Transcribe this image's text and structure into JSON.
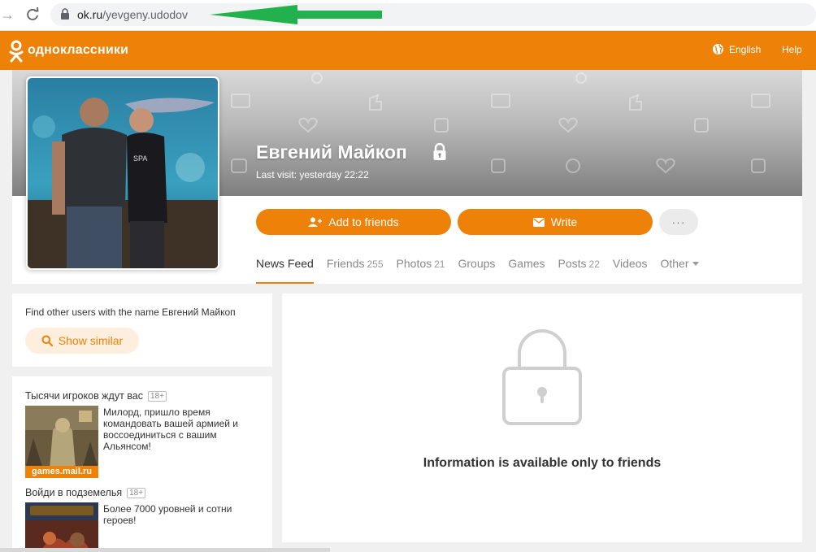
{
  "browser": {
    "url_domain": "ok.ru",
    "url_path": "/yevgeny.udodov"
  },
  "header": {
    "brand": "одноклассники",
    "language": "English",
    "help": "Help",
    "accent_color": "#ee8208"
  },
  "profile": {
    "name": "Евгений Майкоп",
    "last_visit": "Last visit: yesterday 22:22",
    "add_friend_label": "Add to friends",
    "write_label": "Write",
    "more_label": "···"
  },
  "tabs": [
    {
      "label": "News Feed",
      "count": ""
    },
    {
      "label": "Friends",
      "count": "255"
    },
    {
      "label": "Photos",
      "count": "21"
    },
    {
      "label": "Groups",
      "count": ""
    },
    {
      "label": "Games",
      "count": ""
    },
    {
      "label": "Posts",
      "count": "22"
    },
    {
      "label": "Videos",
      "count": ""
    },
    {
      "label": "Other",
      "count": ""
    }
  ],
  "sidebar": {
    "similar_text": "Find other users with the name Евгений Майкоп",
    "show_similar_label": "Show similar",
    "ads": [
      {
        "title": "Тысячи игроков ждут вас",
        "age": "18+",
        "desc": "Милорд, пришло время командовать вашей армией и воссоединиться с вашим Альянсом!",
        "source": "games.mail.ru"
      },
      {
        "title": "Войди в подземелья",
        "age": "18+",
        "desc": "Более 7000 уровней и сотни героев!"
      }
    ]
  },
  "main": {
    "locked_message": "Information is available only to friends"
  }
}
